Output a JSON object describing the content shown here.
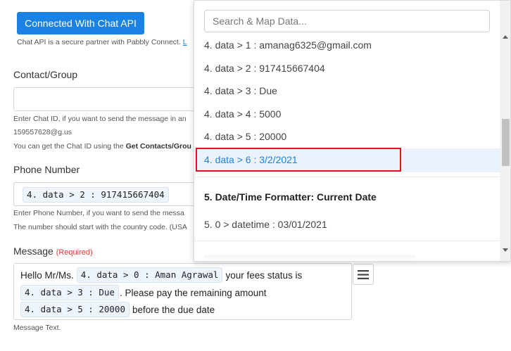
{
  "connect_button": "Connected With Chat API",
  "api_note": {
    "text": "Chat API is a secure partner with Pabbly Connect.",
    "link": "L"
  },
  "contact": {
    "label": "Contact/Group",
    "help1": "Enter Chat ID, if you want to send the message in an",
    "help2": "159557628@g.us",
    "help3_prefix": "You can get the Chat ID using the",
    "help3_bold": "Get Contacts/Grou"
  },
  "phone": {
    "label": "Phone Number",
    "chip": "4. data > 2 : 917415667404",
    "help1": "Enter Phone Number, if you want to send the messa",
    "help2": "The number should start with the country code. (USA"
  },
  "message": {
    "label": "Message",
    "required": "(Required)",
    "line1_pre": "Hello Mr/Ms.",
    "line1_chip": "4. data > 0 : Aman Agrawal",
    "line1_post": "your fees status is",
    "line2_chip": "4. data > 3 : Due",
    "line2_post": ". Please pay the remaining amount",
    "line3_chip": "4. data > 5 : 20000",
    "line3_post": "before the due date",
    "help": "Message Text."
  },
  "dropdown": {
    "search_placeholder": "Search & Map Data...",
    "options": [
      "4. data > 1 : amanag6325@gmail.com",
      "4. data > 2 : 917415667404",
      "4. data > 3 : Due",
      "4. data > 4 : 5000",
      "4. data > 5 : 20000",
      "4. data > 6 : 3/2/2021"
    ],
    "section_title": "5. Date/Time Formatter: Current Date",
    "section_option": "5. 0 > datetime : 03/01/2021"
  },
  "colors": {
    "primary": "#1a82e2",
    "highlight_border": "#e0151b",
    "required": "#e03838"
  },
  "icons": {
    "menu": "hamburger-icon"
  }
}
